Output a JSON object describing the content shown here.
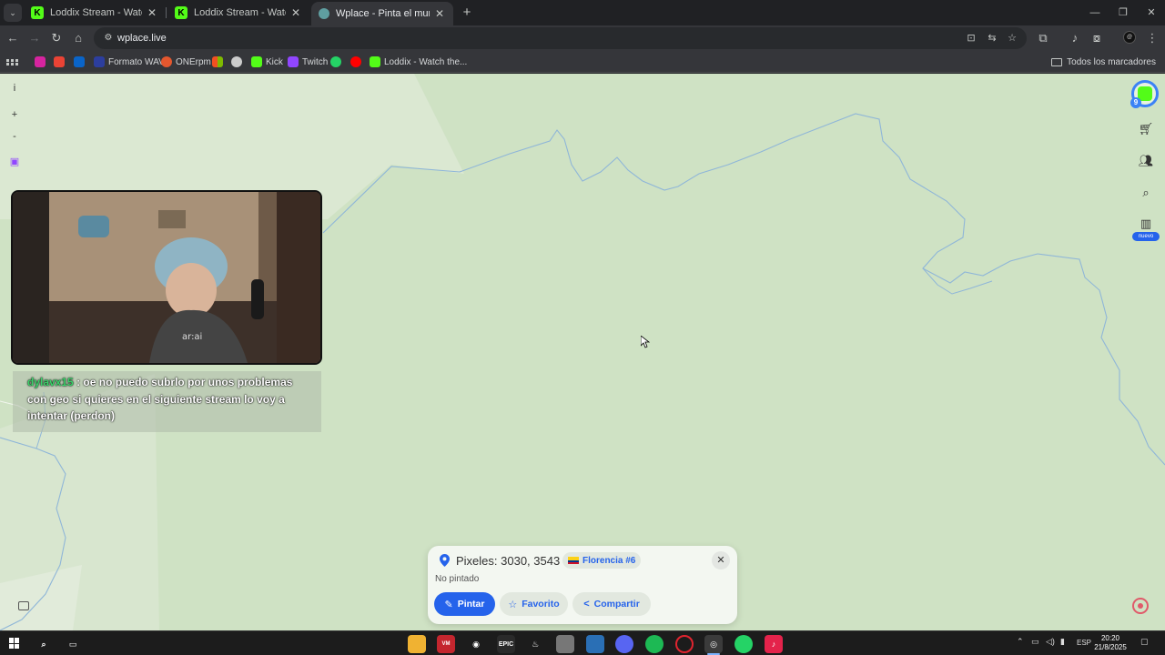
{
  "browser": {
    "tabs": [
      {
        "label": "Loddix Stream - Watch Live on",
        "active": false,
        "favicon": "kick-icon"
      },
      {
        "label": "Loddix Stream - Watch Live on",
        "active": false,
        "favicon": "kick-icon"
      },
      {
        "label": "Wplace - Pinta el mundo",
        "active": true,
        "favicon": "wplace-icon"
      }
    ],
    "url": "wplace.live",
    "bookmarks": [
      {
        "label": "",
        "icon": "instagram-icon",
        "color": "#d6249f"
      },
      {
        "label": "",
        "icon": "gmail-icon",
        "color": "#ea4335"
      },
      {
        "label": "",
        "icon": "outlook-icon",
        "color": "#0a64c8"
      },
      {
        "label": "Formato WAV",
        "icon": "wav-icon",
        "color": "#2c3e9e"
      },
      {
        "label": "ONErpm",
        "icon": "onerpm-icon",
        "color": "#e4572e"
      },
      {
        "label": "",
        "icon": "microsoft-icon",
        "color": "#f25022"
      },
      {
        "label": "",
        "icon": "chatgpt-icon",
        "color": "#cccccc"
      },
      {
        "label": "Kick",
        "icon": "kick-icon",
        "color": "#53fc18"
      },
      {
        "label": "Twitch",
        "icon": "twitch-icon",
        "color": "#9146ff"
      },
      {
        "label": "",
        "icon": "whatsapp-icon",
        "color": "#25d366"
      },
      {
        "label": "",
        "icon": "youtube-icon",
        "color": "#ff0000"
      },
      {
        "label": "Loddix - Watch the...",
        "icon": "kick-icon",
        "color": "#53fc18"
      }
    ],
    "all_bookmarks_label": "Todos los marcadores"
  },
  "map": {
    "level": "9",
    "new_badge": "nuevo",
    "chat": {
      "user": "dylavx15",
      "separator": ":",
      "message": "oe no puedo subrlo por unos problemas con geo si quieres en el siguiente stream lo voy a intentar (perdon)"
    },
    "pixel_card": {
      "coords": "Pixeles: 3030, 3543",
      "region": "Florencia #6",
      "status": "No pintado",
      "paint_label": "Pintar",
      "favorite_label": "Favorito",
      "share_label": "Compartir"
    }
  },
  "taskbar": {
    "language": "ESP",
    "time": "20:20",
    "date": "21/8/2025"
  }
}
